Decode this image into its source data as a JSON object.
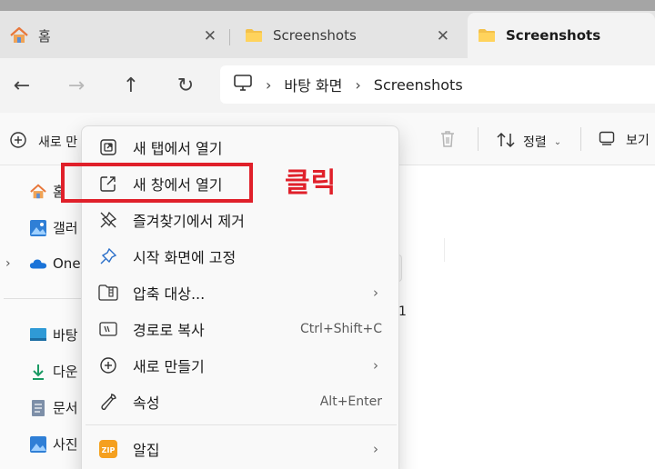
{
  "tabs": [
    {
      "label": "홈",
      "icon": "home-icon"
    },
    {
      "label": "Screenshots",
      "icon": "folder-icon"
    },
    {
      "label": "Screenshots",
      "icon": "folder-icon",
      "active": true
    }
  ],
  "nav": {
    "breadcrumb": [
      "바탕 화면",
      "Screenshots"
    ]
  },
  "commandbar": {
    "new_label": "새로 만",
    "sort_label": "정렬",
    "view_label": "보기"
  },
  "navpane": {
    "items": [
      {
        "label": "홈",
        "icon": "home-icon"
      },
      {
        "label": "갤러",
        "icon": "gallery-icon"
      },
      {
        "label": "OneI",
        "icon": "onedrive-icon"
      },
      {
        "label": "바탕",
        "icon": "desktop-icon"
      },
      {
        "label": "다운",
        "icon": "download-icon"
      },
      {
        "label": "문서",
        "icon": "document-icon"
      },
      {
        "label": "사진",
        "icon": "pictures-icon"
      }
    ]
  },
  "background_fragment": "1",
  "context_menu": {
    "items": [
      {
        "label": "새 탭에서 열기",
        "icon": "open-new-tab-icon"
      },
      {
        "label": "새 창에서 열기",
        "icon": "open-new-window-icon"
      },
      {
        "label": "즐겨찾기에서 제거",
        "icon": "unpin-icon"
      },
      {
        "label": "시작 화면에 고정",
        "icon": "pin-icon"
      },
      {
        "label": "압축 대상...",
        "icon": "zip-folder-icon",
        "submenu": true
      },
      {
        "label": "경로로 복사",
        "icon": "copy-path-icon",
        "shortcut": "Ctrl+Shift+C"
      },
      {
        "label": "새로 만들기",
        "icon": "new-icon",
        "submenu": true
      },
      {
        "label": "속성",
        "icon": "properties-icon",
        "shortcut": "Alt+Enter"
      },
      {
        "label": "알집",
        "icon": "alzip-icon",
        "submenu": true
      }
    ]
  },
  "annotation": {
    "text": "클릭",
    "color": "#e0202a"
  }
}
